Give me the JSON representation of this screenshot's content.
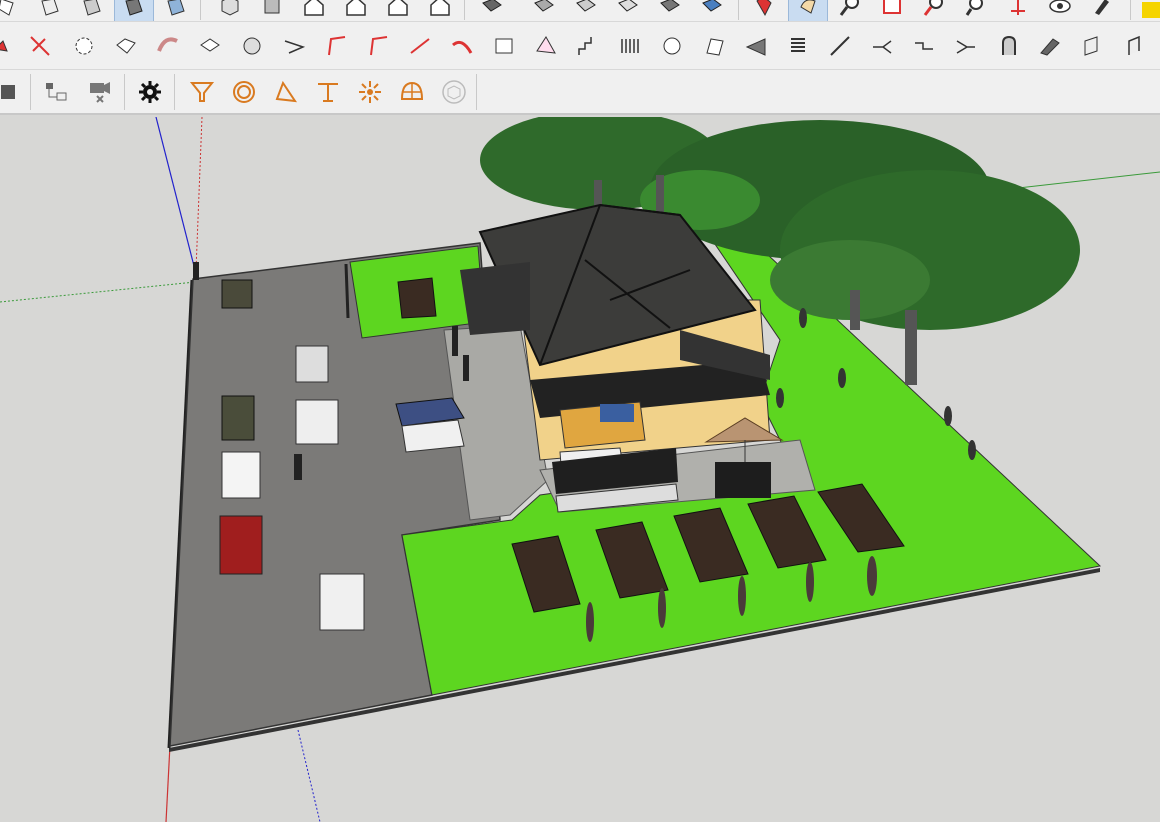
{
  "toolbars": {
    "row1": [
      "select-tool-icon",
      "eraser-tool-icon",
      "paint-bucket-icon",
      "component-icon",
      "push-pull-icon",
      "iso-view-icon",
      "top-view-icon",
      "front-view-icon",
      "right-view-icon",
      "back-view-icon",
      "left-view-icon",
      "section-plane-icon",
      "section-cut-icon",
      "section-fill-icon",
      "display-section-icon",
      "sandbox-from-contours-icon",
      "sandbox-smoove-icon",
      "sandbox-stamp-icon",
      "zoom-icon",
      "zoom-extents-icon",
      "zoom-window-icon",
      "walk-icon",
      "look-around-icon",
      "position-camera-icon",
      "shadow-icon",
      "styles-icon"
    ],
    "row2": [
      "arc-tool-icon",
      "offset-tool-icon",
      "rotate-tool-icon",
      "follow-me-icon",
      "bend-tool-icon",
      "box-tool-icon",
      "sphere-tool-icon",
      "scale-tool-icon",
      "chamfer-icon",
      "fillet-icon",
      "cut-line-icon",
      "extrude-path-icon",
      "roof-tool-icon",
      "pyramid-tool-icon",
      "stair-tool-icon",
      "fence-tool-icon",
      "hand-tool-icon",
      "fold-tool-icon",
      "mirror-tool-icon",
      "stack-tool-icon",
      "pen-line-icon",
      "path-fork-icon",
      "path-split-icon",
      "path-merge-icon",
      "spiral-stair-icon",
      "straight-stair-icon",
      "window-tool-icon",
      "door-tool-icon"
    ],
    "row3": [
      "square-stop-icon",
      "scene-tree-icon",
      "camera-off-icon",
      "settings-icon",
      "light-spot-icon",
      "light-omni-icon",
      "light-area-icon",
      "light-ies-icon",
      "light-sun-icon",
      "dome-light-icon",
      "box-light-icon"
    ]
  },
  "colors": {
    "toolbar_bg": "#f0f0f0",
    "viewport_bg": "#d7d7d5",
    "grass": "#5dd620",
    "asphalt": "#7b7a78",
    "roof": "#3c3c3a",
    "wall": "#f1d28a",
    "accent_orange": "#d97a20"
  }
}
